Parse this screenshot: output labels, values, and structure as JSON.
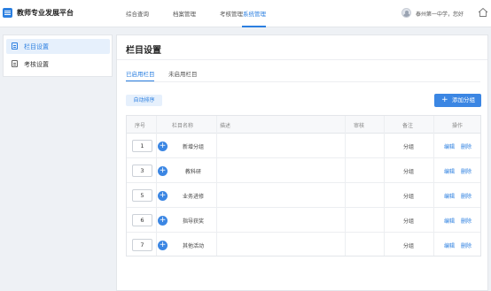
{
  "app": {
    "title": "教师专业发展平台"
  },
  "nav": [
    {
      "label": "综合查询"
    },
    {
      "label": "档案管理"
    },
    {
      "label": "考核管理"
    },
    {
      "label": "系统管理"
    }
  ],
  "user": {
    "greeting": "泰州第一中学，您好"
  },
  "sidebar": {
    "items": [
      {
        "label": "栏目设置"
      },
      {
        "label": "考核设置"
      }
    ]
  },
  "main": {
    "title": "栏目设置",
    "tabs": [
      {
        "label": "已启用栏目"
      },
      {
        "label": "未启用栏目"
      }
    ],
    "auto_sort_label": "自动排序",
    "add_group_label": "添加分组"
  },
  "table": {
    "headers": [
      "序号",
      "栏目名称",
      "描述",
      "审核",
      "备注",
      "操作"
    ],
    "rows": [
      {
        "order": "1",
        "name": "新增分组",
        "type": "分组",
        "edit": "编辑",
        "delete": "删除"
      },
      {
        "order": "3",
        "name": "教科研",
        "type": "分组",
        "edit": "编辑",
        "delete": "删除"
      },
      {
        "order": "5",
        "name": "业务进修",
        "type": "分组",
        "edit": "编辑",
        "delete": "删除"
      },
      {
        "order": "6",
        "name": "指导获奖",
        "type": "分组",
        "edit": "编辑",
        "delete": "删除"
      },
      {
        "order": "7",
        "name": "其他活动",
        "type": "分组",
        "edit": "编辑",
        "delete": "删除"
      }
    ]
  },
  "colors": {
    "accent": "#2b7fe0",
    "button": "#3b86e3"
  },
  "icons": {
    "logo": "app-logo-icon",
    "home": "home-icon",
    "plus": "plus-icon",
    "doc": "document-icon"
  }
}
